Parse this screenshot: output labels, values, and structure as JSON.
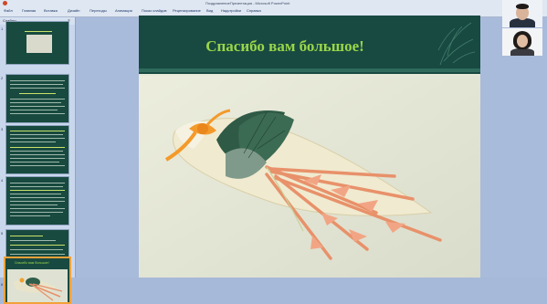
{
  "window": {
    "title": "ПоздравлениеПрезентация - Microsoft PowerPoint"
  },
  "ribbon": {
    "tabs": [
      "Файл",
      "Главная",
      "Вставка",
      "Дизайн",
      "Переходы",
      "Анимация",
      "Показ слайдов",
      "Рецензирование",
      "Вид",
      "Надстройки",
      "Справка"
    ]
  },
  "panel": {
    "header": "Слайды",
    "close": "×",
    "slide_numbers": [
      "1",
      "2",
      "3",
      "4",
      "5",
      "6"
    ]
  },
  "slide": {
    "heading": "Спасибо вам большое!"
  },
  "thumb6": {
    "caption": "Спасибо вам большое!"
  },
  "colors": {
    "slide_header": "#184a41",
    "heading": "#9ad64a",
    "selection": "#f2a13a"
  }
}
